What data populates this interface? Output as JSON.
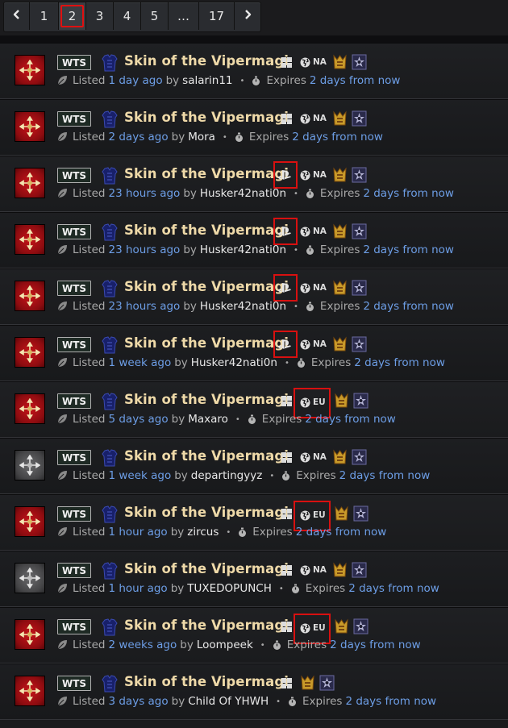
{
  "pagination": {
    "prev_label": "‹",
    "next_label": "›",
    "pages": [
      "1",
      "2",
      "3",
      "4",
      "5",
      "…",
      "17"
    ],
    "active": "2"
  },
  "listing_common": {
    "tag": "WTS",
    "listed_prefix": "Listed",
    "by": "by",
    "expires_prefix": "Expires"
  },
  "listings": [
    {
      "thumb": "red",
      "title": "Skin of the Vipermagi",
      "platform": "windows",
      "region": "NA",
      "ladder": true,
      "hardcore": true,
      "listed_ago": "1 day ago",
      "user": "salarin11",
      "expires": "2 days from now"
    },
    {
      "thumb": "red",
      "title": "Skin of the Vipermagi",
      "platform": "windows",
      "region": "NA",
      "ladder": true,
      "hardcore": true,
      "listed_ago": "2 days ago",
      "user": "Mora",
      "expires": "2 days from now"
    },
    {
      "thumb": "red",
      "title": "Skin of the Vipermagi",
      "platform": "playstation",
      "region": "NA",
      "ladder": true,
      "hardcore": true,
      "listed_ago": "23 hours ago",
      "user": "Husker42nati0n",
      "expires": "2 days from now"
    },
    {
      "thumb": "red",
      "title": "Skin of the Vipermagi",
      "platform": "playstation",
      "region": "NA",
      "ladder": true,
      "hardcore": true,
      "listed_ago": "23 hours ago",
      "user": "Husker42nati0n",
      "expires": "2 days from now"
    },
    {
      "thumb": "red",
      "title": "Skin of the Vipermagi",
      "platform": "playstation",
      "region": "NA",
      "ladder": true,
      "hardcore": true,
      "listed_ago": "23 hours ago",
      "user": "Husker42nati0n",
      "expires": "2 days from now"
    },
    {
      "thumb": "red",
      "title": "Skin of the Vipermagi",
      "platform": "playstation",
      "region": "NA",
      "ladder": true,
      "hardcore": true,
      "listed_ago": "1 week ago",
      "user": "Husker42nati0n",
      "expires": "2 days from now"
    },
    {
      "thumb": "red",
      "title": "Skin of the Vipermagi",
      "platform": "windows",
      "region": "EU",
      "ladder": true,
      "hardcore": true,
      "listed_ago": "5 days ago",
      "user": "Maxaro",
      "expires": "2 days from now"
    },
    {
      "thumb": "gray",
      "title": "Skin of the Vipermagi",
      "platform": "windows",
      "region": "NA",
      "ladder": true,
      "hardcore": true,
      "listed_ago": "1 week ago",
      "user": "departingyyz",
      "expires": "2 days from now"
    },
    {
      "thumb": "red",
      "title": "Skin of the Vipermagi",
      "platform": "windows",
      "region": "EU",
      "ladder": true,
      "hardcore": true,
      "listed_ago": "1 hour ago",
      "user": "zircus",
      "expires": "2 days from now"
    },
    {
      "thumb": "gray",
      "title": "Skin of the Vipermagi",
      "platform": "windows",
      "region": "NA",
      "ladder": true,
      "hardcore": true,
      "listed_ago": "1 hour ago",
      "user": "TUXEDOPUNCH",
      "expires": "2 days from now"
    },
    {
      "thumb": "red",
      "title": "Skin of the Vipermagi",
      "platform": "windows",
      "region": "EU",
      "ladder": true,
      "hardcore": true,
      "listed_ago": "2 weeks ago",
      "user": "Loompeek",
      "expires": "2 days from now"
    },
    {
      "thumb": "red",
      "title": "Skin of the Vipermagi",
      "platform": "windows",
      "region": "",
      "ladder": true,
      "hardcore": true,
      "listed_ago": "3 days ago",
      "user": "Child Of YHWH",
      "expires": "2 days from now"
    }
  ],
  "colors": {
    "accent_link": "#6d9ee6",
    "title_gold": "#eed9a8",
    "highlight_box": "#d81010"
  }
}
